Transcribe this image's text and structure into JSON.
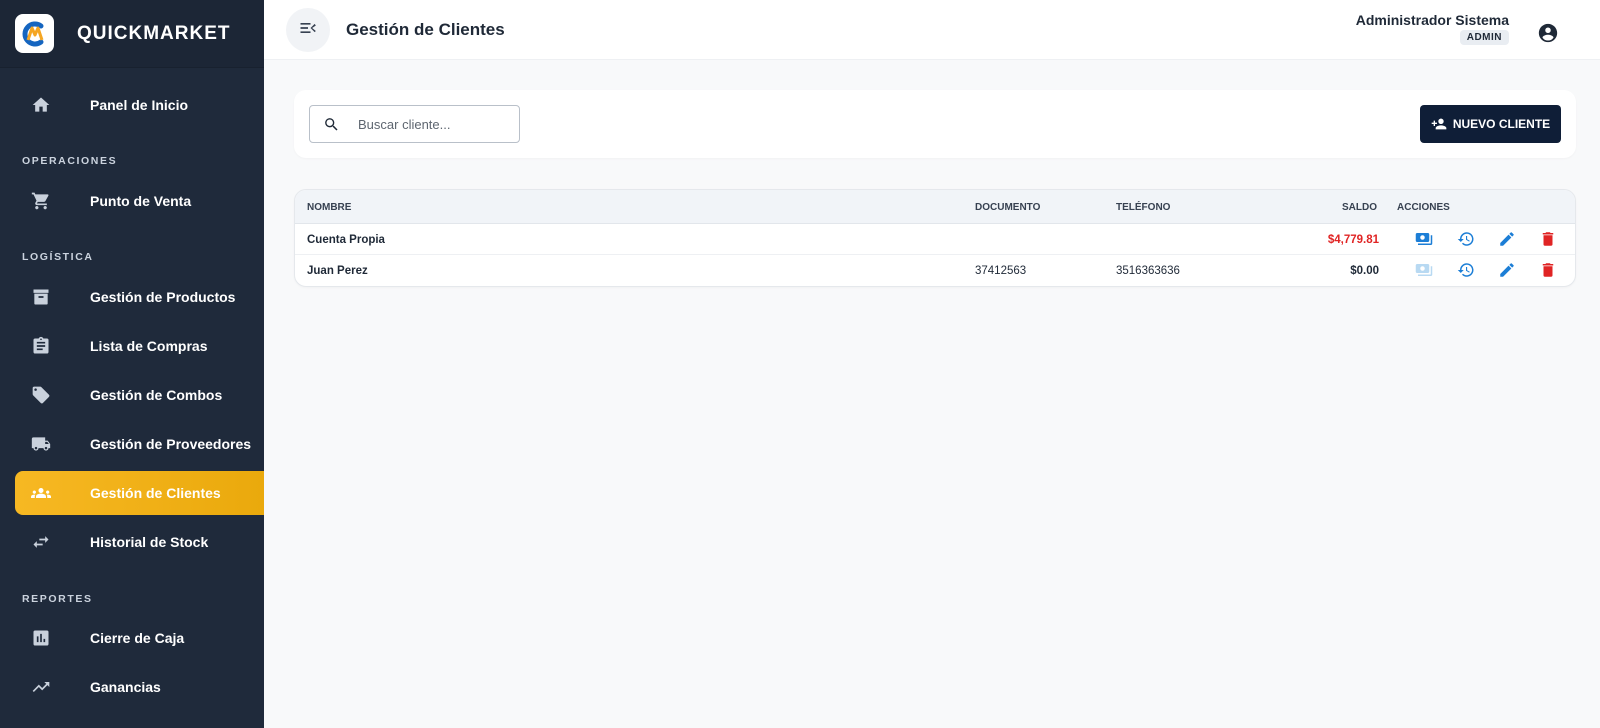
{
  "brand": {
    "name": "QUICKMARKET"
  },
  "sidebar": {
    "sections": [
      "OPERACIONES",
      "LOGÍSTICA",
      "REPORTES"
    ],
    "items": [
      {
        "label": "Panel de Inicio",
        "icon": "home-icon"
      },
      {
        "label": "Punto de Venta",
        "icon": "cart-icon"
      },
      {
        "label": "Gestión de Productos",
        "icon": "archive-icon"
      },
      {
        "label": "Lista de Compras",
        "icon": "clipboard-icon"
      },
      {
        "label": "Gestión de Combos",
        "icon": "tag-icon"
      },
      {
        "label": "Gestión de Proveedores",
        "icon": "truck-icon"
      },
      {
        "label": "Gestión de Clientes",
        "icon": "people-icon",
        "active": true
      },
      {
        "label": "Historial de Stock",
        "icon": "swap-icon"
      },
      {
        "label": "Cierre de Caja",
        "icon": "bar-chart-icon"
      },
      {
        "label": "Ganancias",
        "icon": "trending-up-icon"
      }
    ]
  },
  "header": {
    "title": "Gestión de Clientes",
    "user_name": "Administrador Sistema",
    "user_role": "ADMIN"
  },
  "search": {
    "placeholder": "Buscar cliente...",
    "value": ""
  },
  "toolbar": {
    "new_client_label": "NUEVO CLIENTE"
  },
  "table": {
    "columns": [
      "NOMBRE",
      "DOCUMENTO",
      "TELÉFONO",
      "SALDO",
      "ACCIONES"
    ],
    "rows": [
      {
        "nombre": "Cuenta Propia",
        "documento": "",
        "telefono": "",
        "saldo": "$4,779.81"
      },
      {
        "nombre": "Juan Perez",
        "documento": "37412563",
        "telefono": "3516363636",
        "saldo": "$0.00"
      }
    ]
  },
  "colors": {
    "sidebar_bg": "#1f2a3b",
    "accent": "#f2b11a",
    "primary_button": "#0f1e37",
    "debt_red": "#e02424",
    "action_blue": "#1c7ed6",
    "delete_red": "#e02424"
  }
}
